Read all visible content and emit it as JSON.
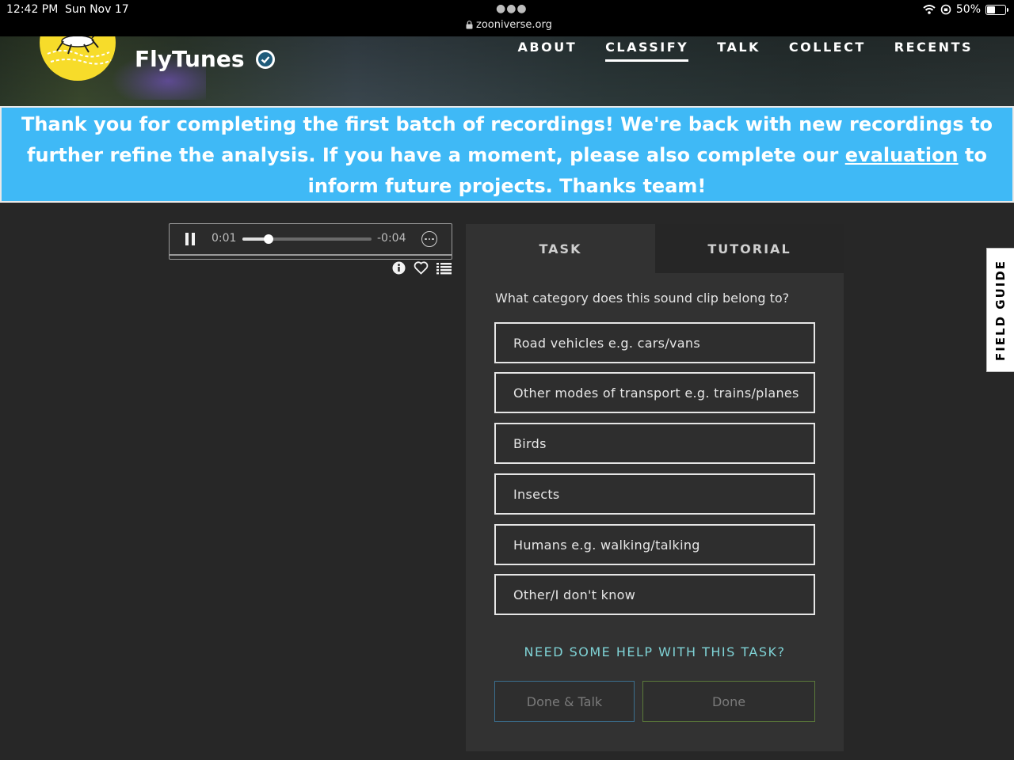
{
  "status_bar": {
    "time": "12:42 PM",
    "date": "Sun Nov 17",
    "url": "zooniverse.org",
    "battery": "50%",
    "battery_level": 0.5
  },
  "header": {
    "project_title": "FlyTunes",
    "nav": [
      "ABOUT",
      "CLASSIFY",
      "TALK",
      "COLLECT",
      "RECENTS"
    ],
    "active_nav": "CLASSIFY"
  },
  "announcement": {
    "text_before": "Thank you for completing the first batch of recordings! We're back with new recordings to further refine the analysis. If you have a moment, please also complete our ",
    "link_text": "evaluation",
    "text_after": " to inform future projects. Thanks team!"
  },
  "player": {
    "current_time": "0:01",
    "remaining_time": "-0:04",
    "progress": 0.2
  },
  "tabs": {
    "task": "TASK",
    "tutorial": "TUTORIAL"
  },
  "task": {
    "question": "What category does this sound clip belong to?",
    "answers": [
      "Road vehicles e.g. cars/vans",
      "Other modes of transport e.g. trains/planes",
      "Birds",
      "Insects",
      "Humans e.g. walking/talking",
      "Other/I don't know"
    ],
    "help_link": "NEED SOME HELP WITH THIS TASK?",
    "done_talk_label": "Done & Talk",
    "done_label": "Done"
  },
  "field_guide": "FIELD GUIDE",
  "colors": {
    "announcement_bg": "#3fb9f6",
    "page_bg": "#272727",
    "panel_bg": "#323232",
    "help_link": "#7fd3d6",
    "logo_bg": "#f7dc2a"
  }
}
